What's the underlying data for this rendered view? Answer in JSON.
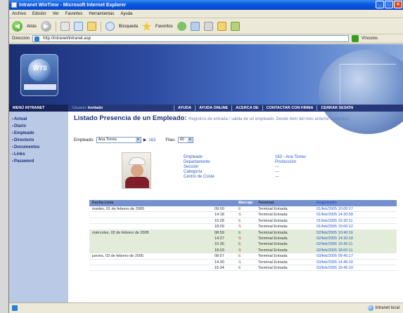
{
  "window": {
    "title": "Intranet WinTime - Microsoft Internet Explorer"
  },
  "menu": [
    "Archivo",
    "Edición",
    "Ver",
    "Favoritos",
    "Herramientas",
    "Ayuda"
  ],
  "toolbar": {
    "back_label": "Atrás",
    "search_label": "Búsqueda",
    "favorites_label": "Favoritos"
  },
  "address": {
    "label": "Dirección",
    "url": "http://intranet/intranet.asp",
    "links_label": "Vínculos"
  },
  "logo": {
    "text": "WTS"
  },
  "nav": {
    "home": "MENÚ INTRANET",
    "user_label": "Usuario:",
    "user_name": "Invitado",
    "links": [
      "AYUDA",
      "AYUDA ONLINE",
      "ACERCA DE",
      "CONTACTAR CON FIRMA",
      "CERRAR SESIÓN"
    ]
  },
  "sidebar": {
    "items": [
      "Actual",
      "Diario",
      "Empleado",
      "Directorio",
      "Documentos",
      "Links",
      "Password"
    ]
  },
  "main": {
    "title": "Listado Presencia de un Empleado:",
    "subtitle": "Registros de entrada / salida de un empleado. Desde ítem del mes anterior hasta hoy.",
    "employee_label": "Empleado:",
    "employee_value": "Ana Torres",
    "code_link": "163",
    "rows_label": "Filas:",
    "rows_value": "40"
  },
  "employee": {
    "fields": [
      {
        "label": "Empleado",
        "value": "163 - Ana Torres"
      },
      {
        "label": "Departamento",
        "value": "Producción"
      },
      {
        "label": "Sección",
        "value": "---"
      },
      {
        "label": "Categoría",
        "value": "---"
      },
      {
        "label": "Centro de Coste",
        "value": "---"
      }
    ]
  },
  "table": {
    "headers": [
      "Fecha Lista",
      "",
      "Marcaje",
      "Terminal",
      "Registrado"
    ],
    "rows": [
      {
        "date": "martes, 01 de febrero de 2005",
        "time": "09:00",
        "dir": "E",
        "term": "Terminal Entrada",
        "reg": "01/feb/2005 10:00:17",
        "shade": false
      },
      {
        "date": "",
        "time": "14:18",
        "dir": "S",
        "term": "Terminal Entrada",
        "reg": "01/feb/2005 14:30:58",
        "shade": false
      },
      {
        "date": "",
        "time": "15:28",
        "dir": "E",
        "term": "Terminal Entrada",
        "reg": "01/feb/2005 15:30:11",
        "shade": false
      },
      {
        "date": "",
        "time": "18:09",
        "dir": "S",
        "term": "Terminal Entrada",
        "reg": "01/feb/2005 19:00:12",
        "shade": false
      },
      {
        "date": "miércoles, 02 de febrero de 2005",
        "time": "08:59",
        "dir": "E",
        "term": "Terminal Entrada",
        "reg": "02/feb/2005 10:40:16",
        "shade": true
      },
      {
        "date": "",
        "time": "14:27",
        "dir": "S",
        "term": "Terminal Entrada",
        "reg": "02/feb/2005 14:30:18",
        "shade": true
      },
      {
        "date": "",
        "time": "15:36",
        "dir": "E",
        "term": "Terminal Entrada",
        "reg": "02/feb/2005 15:45:11",
        "shade": true
      },
      {
        "date": "",
        "time": "18:03",
        "dir": "S",
        "term": "Terminal Entrada",
        "reg": "02/feb/2005 18:00:11",
        "shade": true
      },
      {
        "date": "jueves, 03 de febrero de 2005",
        "time": "08:57",
        "dir": "E",
        "term": "Terminal Entrada",
        "reg": "03/feb/2005 09:45:17",
        "shade": false
      },
      {
        "date": "",
        "time": "14:30",
        "dir": "S",
        "term": "Terminal Entrada",
        "reg": "03/feb/2005 14:45:10",
        "shade": false
      },
      {
        "date": "",
        "time": "15:34",
        "dir": "E",
        "term": "Terminal Entrada",
        "reg": "03/feb/2005 15:45:10",
        "shade": false
      }
    ]
  },
  "status": {
    "zone": "Intranet local"
  },
  "colors": {
    "brand_navy": "#1b2e74",
    "header_blue": "#7391cf",
    "in_green": "#2b8a2b",
    "out_red": "#d12f2f"
  }
}
